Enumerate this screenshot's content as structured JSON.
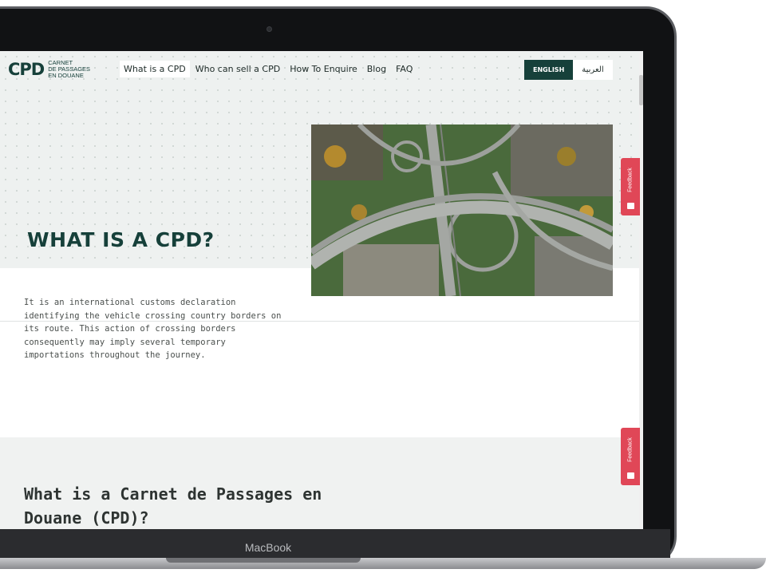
{
  "device": {
    "brand": "MacBook"
  },
  "site": {
    "logo": {
      "mark": "CPD",
      "lines": [
        "Carnet",
        "de Passages",
        "en Douane"
      ]
    },
    "nav": [
      {
        "label": "What is a CPD",
        "active": true
      },
      {
        "label": "Who can sell a CPD",
        "active": false
      },
      {
        "label": "How To Enquire",
        "active": false
      },
      {
        "label": "Blog",
        "active": false
      },
      {
        "label": "FAQ",
        "active": false
      }
    ],
    "language": {
      "english": "ENGLISH",
      "arabic": "العربية"
    }
  },
  "hero": {
    "title": "WHAT IS A CPD?",
    "image": "aerial-highway-interchange"
  },
  "intro": {
    "text": "It is an international customs declaration identifying the vehicle crossing country borders on its route. This action of crossing borders consequently may imply several temporary importations throughout the journey."
  },
  "section2": {
    "title": "What is a Carnet de Passages en Douane (CPD)?"
  },
  "feedback": {
    "label": "Feedback"
  },
  "colors": {
    "brand": "#16403a",
    "feedback": "#e04757",
    "hero_bg": "#eef1f0"
  }
}
